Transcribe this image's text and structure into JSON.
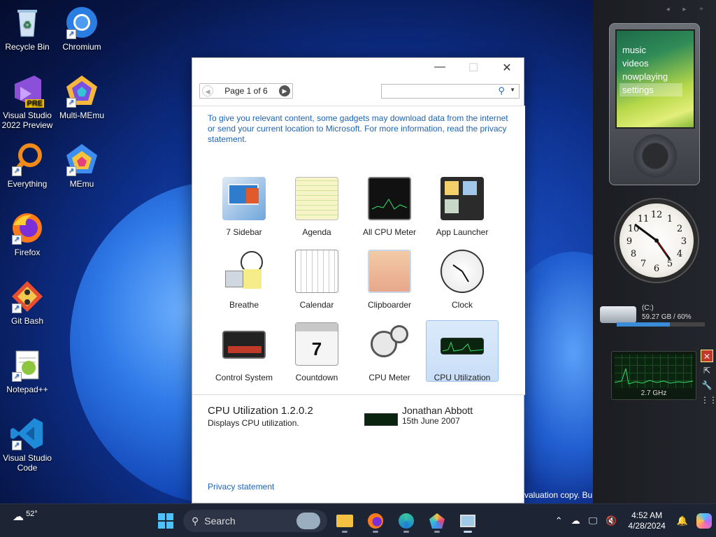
{
  "desktop": {
    "icons": [
      {
        "label": "Recycle Bin"
      },
      {
        "label": "Chromium"
      },
      {
        "label": "Visual Studio 2022 Preview",
        "badge": "PRE"
      },
      {
        "label": "Multi-MEmu"
      },
      {
        "label": "Everything"
      },
      {
        "label": "MEmu"
      },
      {
        "label": "Firefox"
      },
      {
        "label": "Git Bash"
      },
      {
        "label": "Notepad++"
      },
      {
        "label": "Visual Studio Code"
      }
    ],
    "watermark": "valuation copy. Bu"
  },
  "sidebar": {
    "zune": {
      "menu": [
        "music",
        "videos",
        "nowplaying",
        "settings"
      ],
      "selected": "settings"
    },
    "drive": {
      "label": "(C:)",
      "usage": "59.27 GB / 60%",
      "fill_fraction": 0.6
    },
    "cpu": {
      "frequency": "2.7 GHz"
    }
  },
  "dialog": {
    "pager": {
      "label": "Page 1 of 6"
    },
    "search": {
      "placeholder": ""
    },
    "notice": "To give you relevant content, some gadgets may download data from the internet or send your current location to Microsoft. For more information, read the privacy statement.",
    "gadgets": [
      {
        "name": "7 Sidebar"
      },
      {
        "name": "Agenda"
      },
      {
        "name": "All CPU Meter"
      },
      {
        "name": "App Launcher"
      },
      {
        "name": "Breathe"
      },
      {
        "name": "Calendar"
      },
      {
        "name": "Clipboarder"
      },
      {
        "name": "Clock"
      },
      {
        "name": "Control System"
      },
      {
        "name": "Countdown"
      },
      {
        "name": "CPU Meter"
      },
      {
        "name": "CPU Utilization"
      }
    ],
    "selected_gadget": "CPU Utilization",
    "details": {
      "title": "CPU Utilization 1.2.0.2",
      "description": "Displays CPU utilization.",
      "author": "Jonathan Abbott",
      "date": "15th June 2007"
    },
    "privacy_link": "Privacy statement"
  },
  "taskbar": {
    "weather": "52°",
    "search_label": "Search",
    "time": "4:52 AM",
    "date": "4/28/2024"
  }
}
